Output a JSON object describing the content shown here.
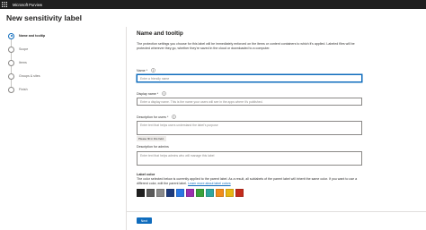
{
  "app": {
    "title": "Microsoft Purview"
  },
  "page": {
    "title": "New sensitivity label"
  },
  "steps": [
    {
      "label": "Name and tooltip",
      "active": true
    },
    {
      "label": "Scope",
      "active": false
    },
    {
      "label": "Items",
      "active": false
    },
    {
      "label": "Groups & sites",
      "active": false
    },
    {
      "label": "Finish",
      "active": false
    }
  ],
  "section": {
    "title": "Name and tooltip",
    "description": "The protection settings you choose for this label will be immediately enforced on the items or content containers to which it's applied. Labeled files will be protected wherever they go, whether they're saved in the cloud or downloaded to a computer."
  },
  "fields": {
    "name": {
      "label": "Name *",
      "placeholder": "Enter a friendly name"
    },
    "display_name": {
      "label": "Display name *",
      "placeholder": "Enter a display name. This is the name your users will see in the apps where it's published."
    },
    "desc_users": {
      "label": "Description for users *",
      "placeholder": "Enter text that helps users understand the label's purpose",
      "chip": "Please fill in this field."
    },
    "desc_admins": {
      "label": "Description for admins",
      "placeholder": "Enter text that helps admins who will manage this label"
    }
  },
  "label_color": {
    "heading": "Label color",
    "description": "The color selected below is currently applied to the parent label. As a result, all sublabels of the parent label will inherit the same color. If you want to use a different color, edit the parent label.",
    "link": "Learn more about label colors",
    "swatches": [
      "#1f1f1f",
      "#5b5b5b",
      "#8a8a8a",
      "#1e3a7b",
      "#2b78e4",
      "#9b2fae",
      "#3aa33a",
      "#2fa7a0",
      "#f28c1c",
      "#e8b713",
      "#c42b1c"
    ]
  },
  "footer": {
    "next_label": "Next"
  }
}
